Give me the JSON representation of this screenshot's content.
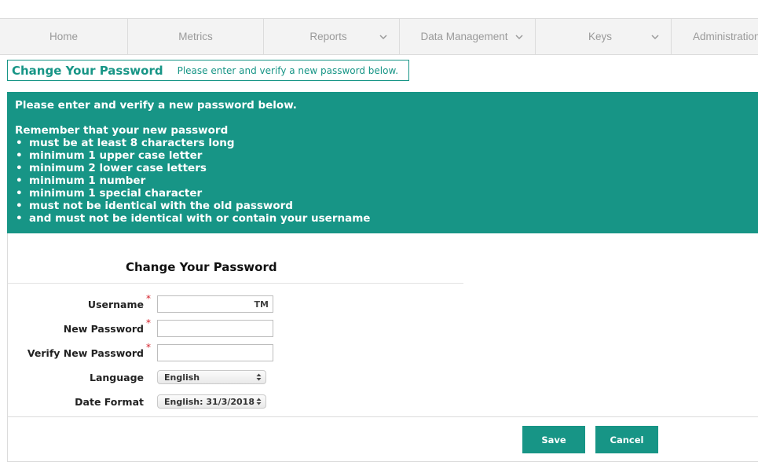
{
  "nav": {
    "items": [
      {
        "label": "Home",
        "chevron": false
      },
      {
        "label": "Metrics",
        "chevron": false
      },
      {
        "label": "Reports",
        "chevron": true
      },
      {
        "label": "Data Management",
        "chevron": true
      },
      {
        "label": "Keys",
        "chevron": true
      },
      {
        "label": "Administration",
        "chevron": false
      }
    ]
  },
  "header": {
    "title": "Change Your Password",
    "subtitle": "Please enter and verify a new password below."
  },
  "info": {
    "intro": "Please enter and verify a new password below.",
    "remember": "Remember that your new password",
    "rules": [
      "must be at least 8 characters long",
      "minimum 1 upper case letter",
      "minimum 2 lower case letters",
      "minimum 1 number",
      "minimum 1 special character",
      "must not be identical with the old password",
      "and must not be identical with or contain your username"
    ]
  },
  "form": {
    "title": "Change Your Password",
    "required_mark": "*",
    "username": {
      "label": "Username",
      "value": "TM"
    },
    "new_password": {
      "label": "New Password",
      "value": ""
    },
    "verify_password": {
      "label": "Verify New Password",
      "value": ""
    },
    "language": {
      "label": "Language",
      "selected": "English"
    },
    "date_format": {
      "label": "Date Format",
      "selected": "English: 31/3/2018"
    }
  },
  "buttons": {
    "save": "Save",
    "cancel": "Cancel"
  },
  "colors": {
    "accent": "#179586",
    "required": "#d4202a"
  }
}
